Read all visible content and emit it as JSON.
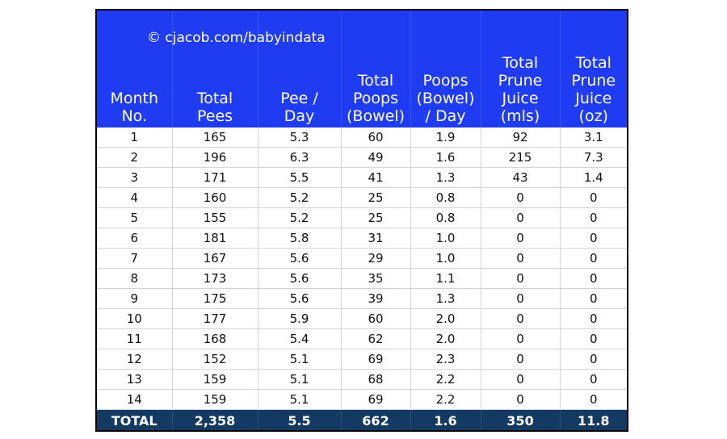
{
  "watermark": "© cjacob.com/babyindata",
  "colors": {
    "header_bg": "#1f3cf2",
    "total_row_bg": "#143a64",
    "text": "#111111"
  },
  "columns": [
    [
      "Month",
      "No."
    ],
    [
      "Total",
      "Pees"
    ],
    [
      "Pee /",
      "Day"
    ],
    [
      "Total",
      "Poops",
      "(Bowel)"
    ],
    [
      "Poops",
      "(Bowel)",
      "/ Day"
    ],
    [
      "Total",
      "Prune",
      "Juice",
      "(mls)"
    ],
    [
      "Total",
      "Prune",
      "Juice",
      "(oz)"
    ]
  ],
  "rows": [
    [
      "1",
      "165",
      "5.3",
      "60",
      "1.9",
      "92",
      "3.1"
    ],
    [
      "2",
      "196",
      "6.3",
      "49",
      "1.6",
      "215",
      "7.3"
    ],
    [
      "3",
      "171",
      "5.5",
      "41",
      "1.3",
      "43",
      "1.4"
    ],
    [
      "4",
      "160",
      "5.2",
      "25",
      "0.8",
      "0",
      "0"
    ],
    [
      "5",
      "155",
      "5.2",
      "25",
      "0.8",
      "0",
      "0"
    ],
    [
      "6",
      "181",
      "5.8",
      "31",
      "1.0",
      "0",
      "0"
    ],
    [
      "7",
      "167",
      "5.6",
      "29",
      "1.0",
      "0",
      "0"
    ],
    [
      "8",
      "173",
      "5.6",
      "35",
      "1.1",
      "0",
      "0"
    ],
    [
      "9",
      "175",
      "5.6",
      "39",
      "1.3",
      "0",
      "0"
    ],
    [
      "10",
      "177",
      "5.9",
      "60",
      "2.0",
      "0",
      "0"
    ],
    [
      "11",
      "168",
      "5.4",
      "62",
      "2.0",
      "0",
      "0"
    ],
    [
      "12",
      "152",
      "5.1",
      "69",
      "2.3",
      "0",
      "0"
    ],
    [
      "13",
      "159",
      "5.1",
      "68",
      "2.2",
      "0",
      "0"
    ],
    [
      "14",
      "159",
      "5.1",
      "69",
      "2.2",
      "0",
      "0"
    ]
  ],
  "totals": [
    "TOTAL",
    "2,358",
    "5.5",
    "662",
    "1.6",
    "350",
    "11.8"
  ]
}
